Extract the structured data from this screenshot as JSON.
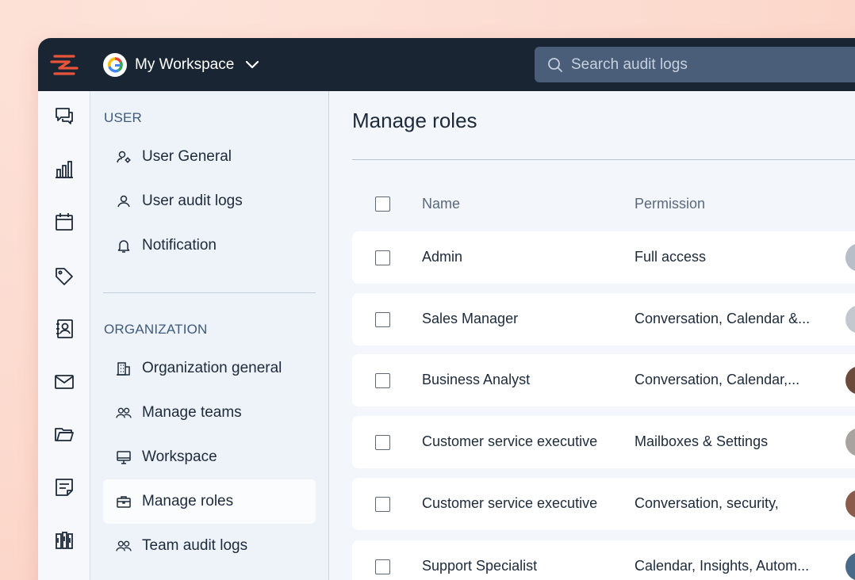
{
  "workspace": {
    "name": "My Workspace"
  },
  "search": {
    "placeholder": "Search audit logs"
  },
  "rail": {
    "icons": [
      "chat-icon",
      "bar-chart-icon",
      "calendar-icon",
      "tag-icon",
      "contacts-icon",
      "mail-icon",
      "folder-icon",
      "notes-icon",
      "library-icon"
    ]
  },
  "sidebar": {
    "user_section": "USER",
    "user_items": [
      {
        "label": "User General",
        "icon": "user-gear-icon"
      },
      {
        "label": "User audit logs",
        "icon": "user-icon"
      },
      {
        "label": "Notification",
        "icon": "bell-icon"
      }
    ],
    "org_section": "ORGANIZATION",
    "org_items": [
      {
        "label": "Organization general",
        "icon": "building-icon"
      },
      {
        "label": "Manage teams",
        "icon": "users-icon"
      },
      {
        "label": "Workspace",
        "icon": "monitor-icon"
      },
      {
        "label": "Manage roles",
        "icon": "briefcase-icon",
        "active": true
      },
      {
        "label": "Team audit logs",
        "icon": "users-icon"
      }
    ]
  },
  "main": {
    "title": "Manage roles",
    "columns": {
      "name": "Name",
      "permission": "Permission"
    },
    "rows": [
      {
        "name": "Admin",
        "permission": "Full access",
        "avatar_color": "#b7bec8"
      },
      {
        "name": "Sales Manager",
        "permission": "Conversation, Calendar &...",
        "avatar_color": "#c3c8cf"
      },
      {
        "name": "Business Analyst",
        "permission": "Conversation, Calendar,...",
        "avatar_color": "#6b4a3a"
      },
      {
        "name": "Customer service executive",
        "permission": "Mailboxes & Settings",
        "avatar_color": "#a9a3a0"
      },
      {
        "name": "Customer service executive",
        "permission": "Conversation, security,",
        "avatar_color": "#8a5a4a"
      },
      {
        "name": "Support Specialist",
        "permission": "Calendar, Insights, Autom...",
        "avatar_color": "#4a6a8a"
      }
    ]
  },
  "colors": {
    "topbar": "#1a2533",
    "accent": "#e8533a",
    "sidebar": "#eef3fa"
  }
}
